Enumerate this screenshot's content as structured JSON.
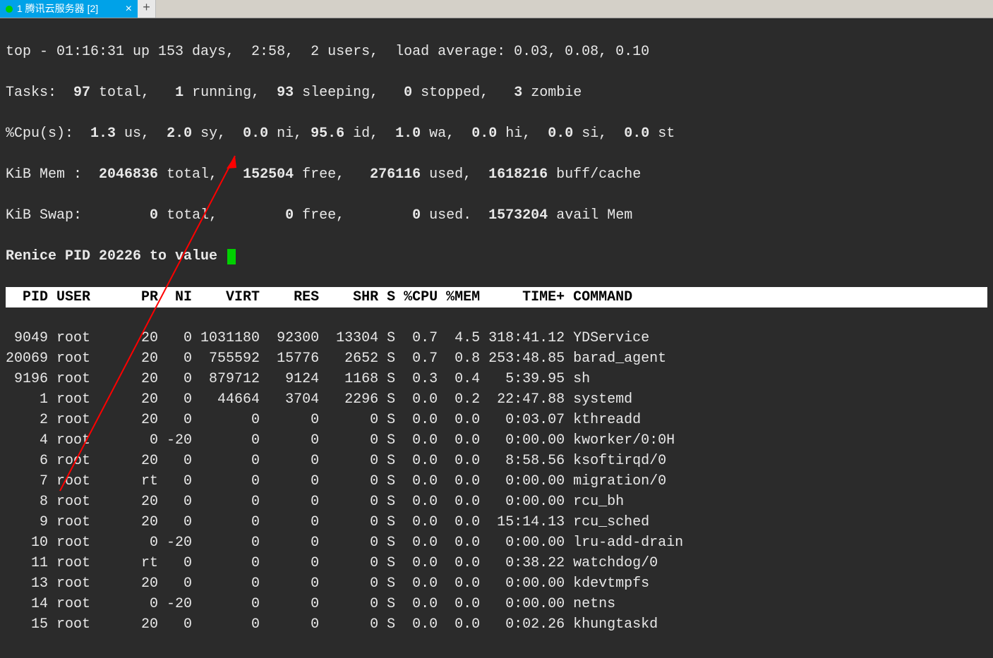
{
  "tab": {
    "title": "1 腾讯云服务器 [2]"
  },
  "summary": {
    "line1_a": "top - 01:16:31 up 153 days,  2:58,  2 users,  load average: 0.03, 0.08, 0.10",
    "tasks_pre": "Tasks:  ",
    "tasks_total": "97",
    "tasks_mid1": " total,   ",
    "tasks_run": "1",
    "tasks_mid2": " running,  ",
    "tasks_sleep": "93",
    "tasks_mid3": " sleeping,   ",
    "tasks_stop": "0",
    "tasks_mid4": " stopped,   ",
    "tasks_zomb": "3",
    "tasks_end": " zombie",
    "cpu_pre": "%Cpu(s):  ",
    "cpu_us": "1.3",
    "cpu_l1": " us,  ",
    "cpu_sy": "2.0",
    "cpu_l2": " sy,  ",
    "cpu_ni": "0.0",
    "cpu_l3": " ni, ",
    "cpu_id": "95.6",
    "cpu_l4": " id,  ",
    "cpu_wa": "1.0",
    "cpu_l5": " wa,  ",
    "cpu_hi": "0.0",
    "cpu_l6": " hi,  ",
    "cpu_si": "0.0",
    "cpu_l7": " si,  ",
    "cpu_st": "0.0",
    "cpu_l8": " st",
    "mem_pre": "KiB Mem :  ",
    "mem_total": "2046836",
    "mem_l1": " total,   ",
    "mem_free": "152504",
    "mem_l2": " free,   ",
    "mem_used": "276116",
    "mem_l3": " used,  ",
    "mem_buff": "1618216",
    "mem_l4": " buff/cache",
    "swap_pre": "KiB Swap:        ",
    "swap_total": "0",
    "swap_l1": " total,        ",
    "swap_free": "0",
    "swap_l2": " free,        ",
    "swap_used": "0",
    "swap_l3": " used.  ",
    "swap_avail": "1573204",
    "swap_l4": " avail Mem"
  },
  "prompt": "Renice PID 20226 to value ",
  "header": "  PID USER      PR  NI    VIRT    RES    SHR S %CPU %MEM     TIME+ COMMAND",
  "chart_data": {
    "type": "table",
    "title": "top process list",
    "columns": [
      "PID",
      "USER",
      "PR",
      "NI",
      "VIRT",
      "RES",
      "SHR",
      "S",
      "%CPU",
      "%MEM",
      "TIME+",
      "COMMAND"
    ],
    "rows": [
      [
        9049,
        "root",
        "20",
        "0",
        1031180,
        92300,
        13304,
        "S",
        0.7,
        4.5,
        "318:41.12",
        "YDService"
      ],
      [
        20069,
        "root",
        "20",
        "0",
        755592,
        15776,
        2652,
        "S",
        0.7,
        0.8,
        "253:48.85",
        "barad_agent"
      ],
      [
        9196,
        "root",
        "20",
        "0",
        879712,
        9124,
        1168,
        "S",
        0.3,
        0.4,
        "5:39.95",
        "sh"
      ],
      [
        1,
        "root",
        "20",
        "0",
        44664,
        3704,
        2296,
        "S",
        0.0,
        0.2,
        "22:47.88",
        "systemd"
      ],
      [
        2,
        "root",
        "20",
        "0",
        0,
        0,
        0,
        "S",
        0.0,
        0.0,
        "0:03.07",
        "kthreadd"
      ],
      [
        4,
        "root",
        "0",
        "-20",
        0,
        0,
        0,
        "S",
        0.0,
        0.0,
        "0:00.00",
        "kworker/0:0H"
      ],
      [
        6,
        "root",
        "20",
        "0",
        0,
        0,
        0,
        "S",
        0.0,
        0.0,
        "8:58.56",
        "ksoftirqd/0"
      ],
      [
        7,
        "root",
        "rt",
        "0",
        0,
        0,
        0,
        "S",
        0.0,
        0.0,
        "0:00.00",
        "migration/0"
      ],
      [
        8,
        "root",
        "20",
        "0",
        0,
        0,
        0,
        "S",
        0.0,
        0.0,
        "0:00.00",
        "rcu_bh"
      ],
      [
        9,
        "root",
        "20",
        "0",
        0,
        0,
        0,
        "S",
        0.0,
        0.0,
        "15:14.13",
        "rcu_sched"
      ],
      [
        10,
        "root",
        "0",
        "-20",
        0,
        0,
        0,
        "S",
        0.0,
        0.0,
        "0:00.00",
        "lru-add-drain"
      ],
      [
        11,
        "root",
        "rt",
        "0",
        0,
        0,
        0,
        "S",
        0.0,
        0.0,
        "0:38.22",
        "watchdog/0"
      ],
      [
        13,
        "root",
        "20",
        "0",
        0,
        0,
        0,
        "S",
        0.0,
        0.0,
        "0:00.00",
        "kdevtmpfs"
      ],
      [
        14,
        "root",
        "0",
        "-20",
        0,
        0,
        0,
        "S",
        0.0,
        0.0,
        "0:00.00",
        "netns"
      ],
      [
        15,
        "root",
        "20",
        "0",
        0,
        0,
        0,
        "S",
        0.0,
        0.0,
        "0:02.26",
        "khungtaskd"
      ]
    ]
  }
}
